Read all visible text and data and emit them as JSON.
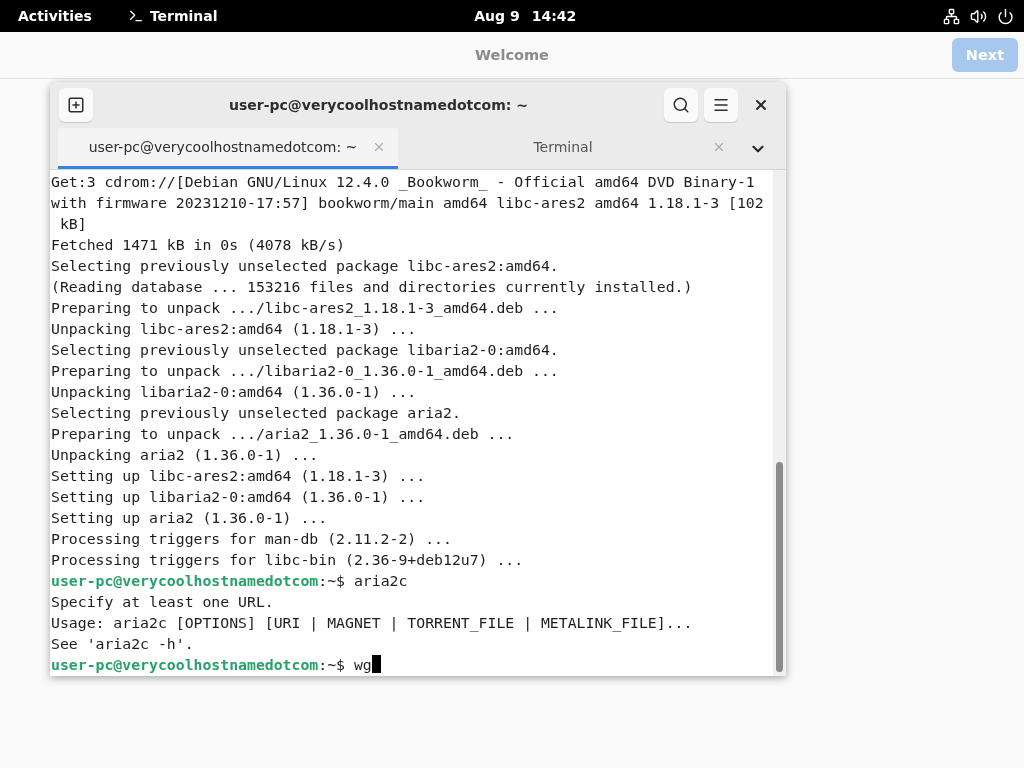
{
  "top_bar": {
    "activities": "Activities",
    "app": "Terminal",
    "date": "Aug 9",
    "time": "14:42"
  },
  "welcome": {
    "title": "Welcome",
    "next_button": {
      "label": "Next",
      "disabled": true
    }
  },
  "terminal": {
    "title": "user-pc@verycoolhostnamedotcom: ~",
    "tabs": [
      {
        "label": "user-pc@verycoolhostnamedotcom: ~",
        "selected": true
      },
      {
        "label": "Terminal",
        "selected": false
      }
    ],
    "lines": [
      {
        "kind": "output",
        "text": "Get:3 cdrom://[Debian GNU/Linux 12.4.0 _Bookworm_ - Official amd64 DVD Binary-1"
      },
      {
        "kind": "output",
        "text": "with firmware 20231210-17:57] bookworm/main amd64 libc-ares2 amd64 1.18.1-3 [102"
      },
      {
        "kind": "output",
        "text": " kB]"
      },
      {
        "kind": "output",
        "text": "Fetched 1471 kB in 0s (4078 kB/s)"
      },
      {
        "kind": "output",
        "text": "Selecting previously unselected package libc-ares2:amd64."
      },
      {
        "kind": "output",
        "text": "(Reading database ... 153216 files and directories currently installed.)"
      },
      {
        "kind": "output",
        "text": "Preparing to unpack .../libc-ares2_1.18.1-3_amd64.deb ..."
      },
      {
        "kind": "output",
        "text": "Unpacking libc-ares2:amd64 (1.18.1-3) ..."
      },
      {
        "kind": "output",
        "text": "Selecting previously unselected package libaria2-0:amd64."
      },
      {
        "kind": "output",
        "text": "Preparing to unpack .../libaria2-0_1.36.0-1_amd64.deb ..."
      },
      {
        "kind": "output",
        "text": "Unpacking libaria2-0:amd64 (1.36.0-1) ..."
      },
      {
        "kind": "output",
        "text": "Selecting previously unselected package aria2."
      },
      {
        "kind": "output",
        "text": "Preparing to unpack .../aria2_1.36.0-1_amd64.deb ..."
      },
      {
        "kind": "output",
        "text": "Unpacking aria2 (1.36.0-1) ..."
      },
      {
        "kind": "output",
        "text": "Setting up libc-ares2:amd64 (1.18.1-3) ..."
      },
      {
        "kind": "output",
        "text": "Setting up libaria2-0:amd64 (1.36.0-1) ..."
      },
      {
        "kind": "output",
        "text": "Setting up aria2 (1.36.0-1) ..."
      },
      {
        "kind": "output",
        "text": "Processing triggers for man-db (2.11.2-2) ..."
      },
      {
        "kind": "output",
        "text": "Processing triggers for libc-bin (2.36-9+deb12u7) ..."
      },
      {
        "kind": "prompt",
        "user": "user-pc@verycoolhostnamedotcom",
        "rest": ":~$ ",
        "command": "aria2c",
        "cursor": false
      },
      {
        "kind": "output",
        "text": "Specify at least one URL."
      },
      {
        "kind": "output",
        "text": "Usage: aria2c [OPTIONS] [URI | MAGNET | TORRENT_FILE | METALINK_FILE]..."
      },
      {
        "kind": "output",
        "text": "See 'aria2c -h'."
      },
      {
        "kind": "prompt",
        "user": "user-pc@verycoolhostnamedotcom",
        "rest": ":~$ ",
        "command": "wg",
        "cursor": true
      }
    ]
  }
}
